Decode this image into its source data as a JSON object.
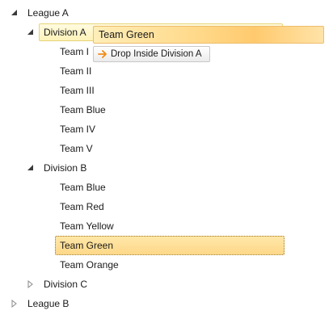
{
  "tree": {
    "league_a": {
      "label": "League A",
      "expanded": true,
      "divisions": {
        "division_a": {
          "label": "Division A",
          "expanded": true,
          "teams": [
            "Team I",
            "Team II",
            "Team III",
            "Team Blue",
            "Team IV",
            "Team V"
          ]
        },
        "division_b": {
          "label": "Division B",
          "expanded": true,
          "teams": [
            "Team Blue",
            "Team Red",
            "Team Yellow",
            "Team Green",
            "Team Orange"
          ],
          "selected_team": "Team Green"
        },
        "division_c": {
          "label": "Division C",
          "expanded": false
        }
      }
    },
    "league_b": {
      "label": "League B",
      "expanded": false
    }
  },
  "drag": {
    "dragged_item": "Team Green",
    "drop_tooltip": "Drop Inside Division A",
    "arrow_icon": "arrow-right-icon",
    "arrow_color": "#f28c1a"
  },
  "colors": {
    "hover_background": "#fff3b8",
    "selected_background": "#fdd889",
    "drag_background": "#ffca6e"
  }
}
